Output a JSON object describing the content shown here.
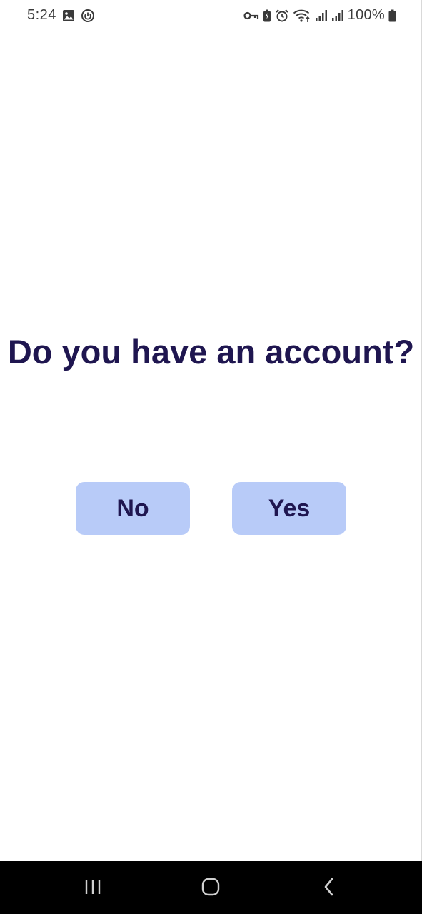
{
  "status_bar": {
    "time": "5:24",
    "battery": "100%",
    "left_icons": [
      "gallery-icon",
      "power-saving-icon"
    ],
    "right_icons": [
      "vpn-key-icon",
      "battery-saver-icon",
      "alarm-icon",
      "wifi-icon",
      "signal-icon",
      "signal-icon",
      "battery-icon"
    ]
  },
  "prompt": {
    "question": "Do you have an account?"
  },
  "buttons": {
    "no_label": "No",
    "yes_label": "Yes"
  },
  "navigation": {
    "icons": [
      "recents-icon",
      "home-icon",
      "back-icon"
    ]
  },
  "colors": {
    "text_primary": "#1f1650",
    "button_background": "#b8cbf8",
    "nav_background": "#000000"
  }
}
